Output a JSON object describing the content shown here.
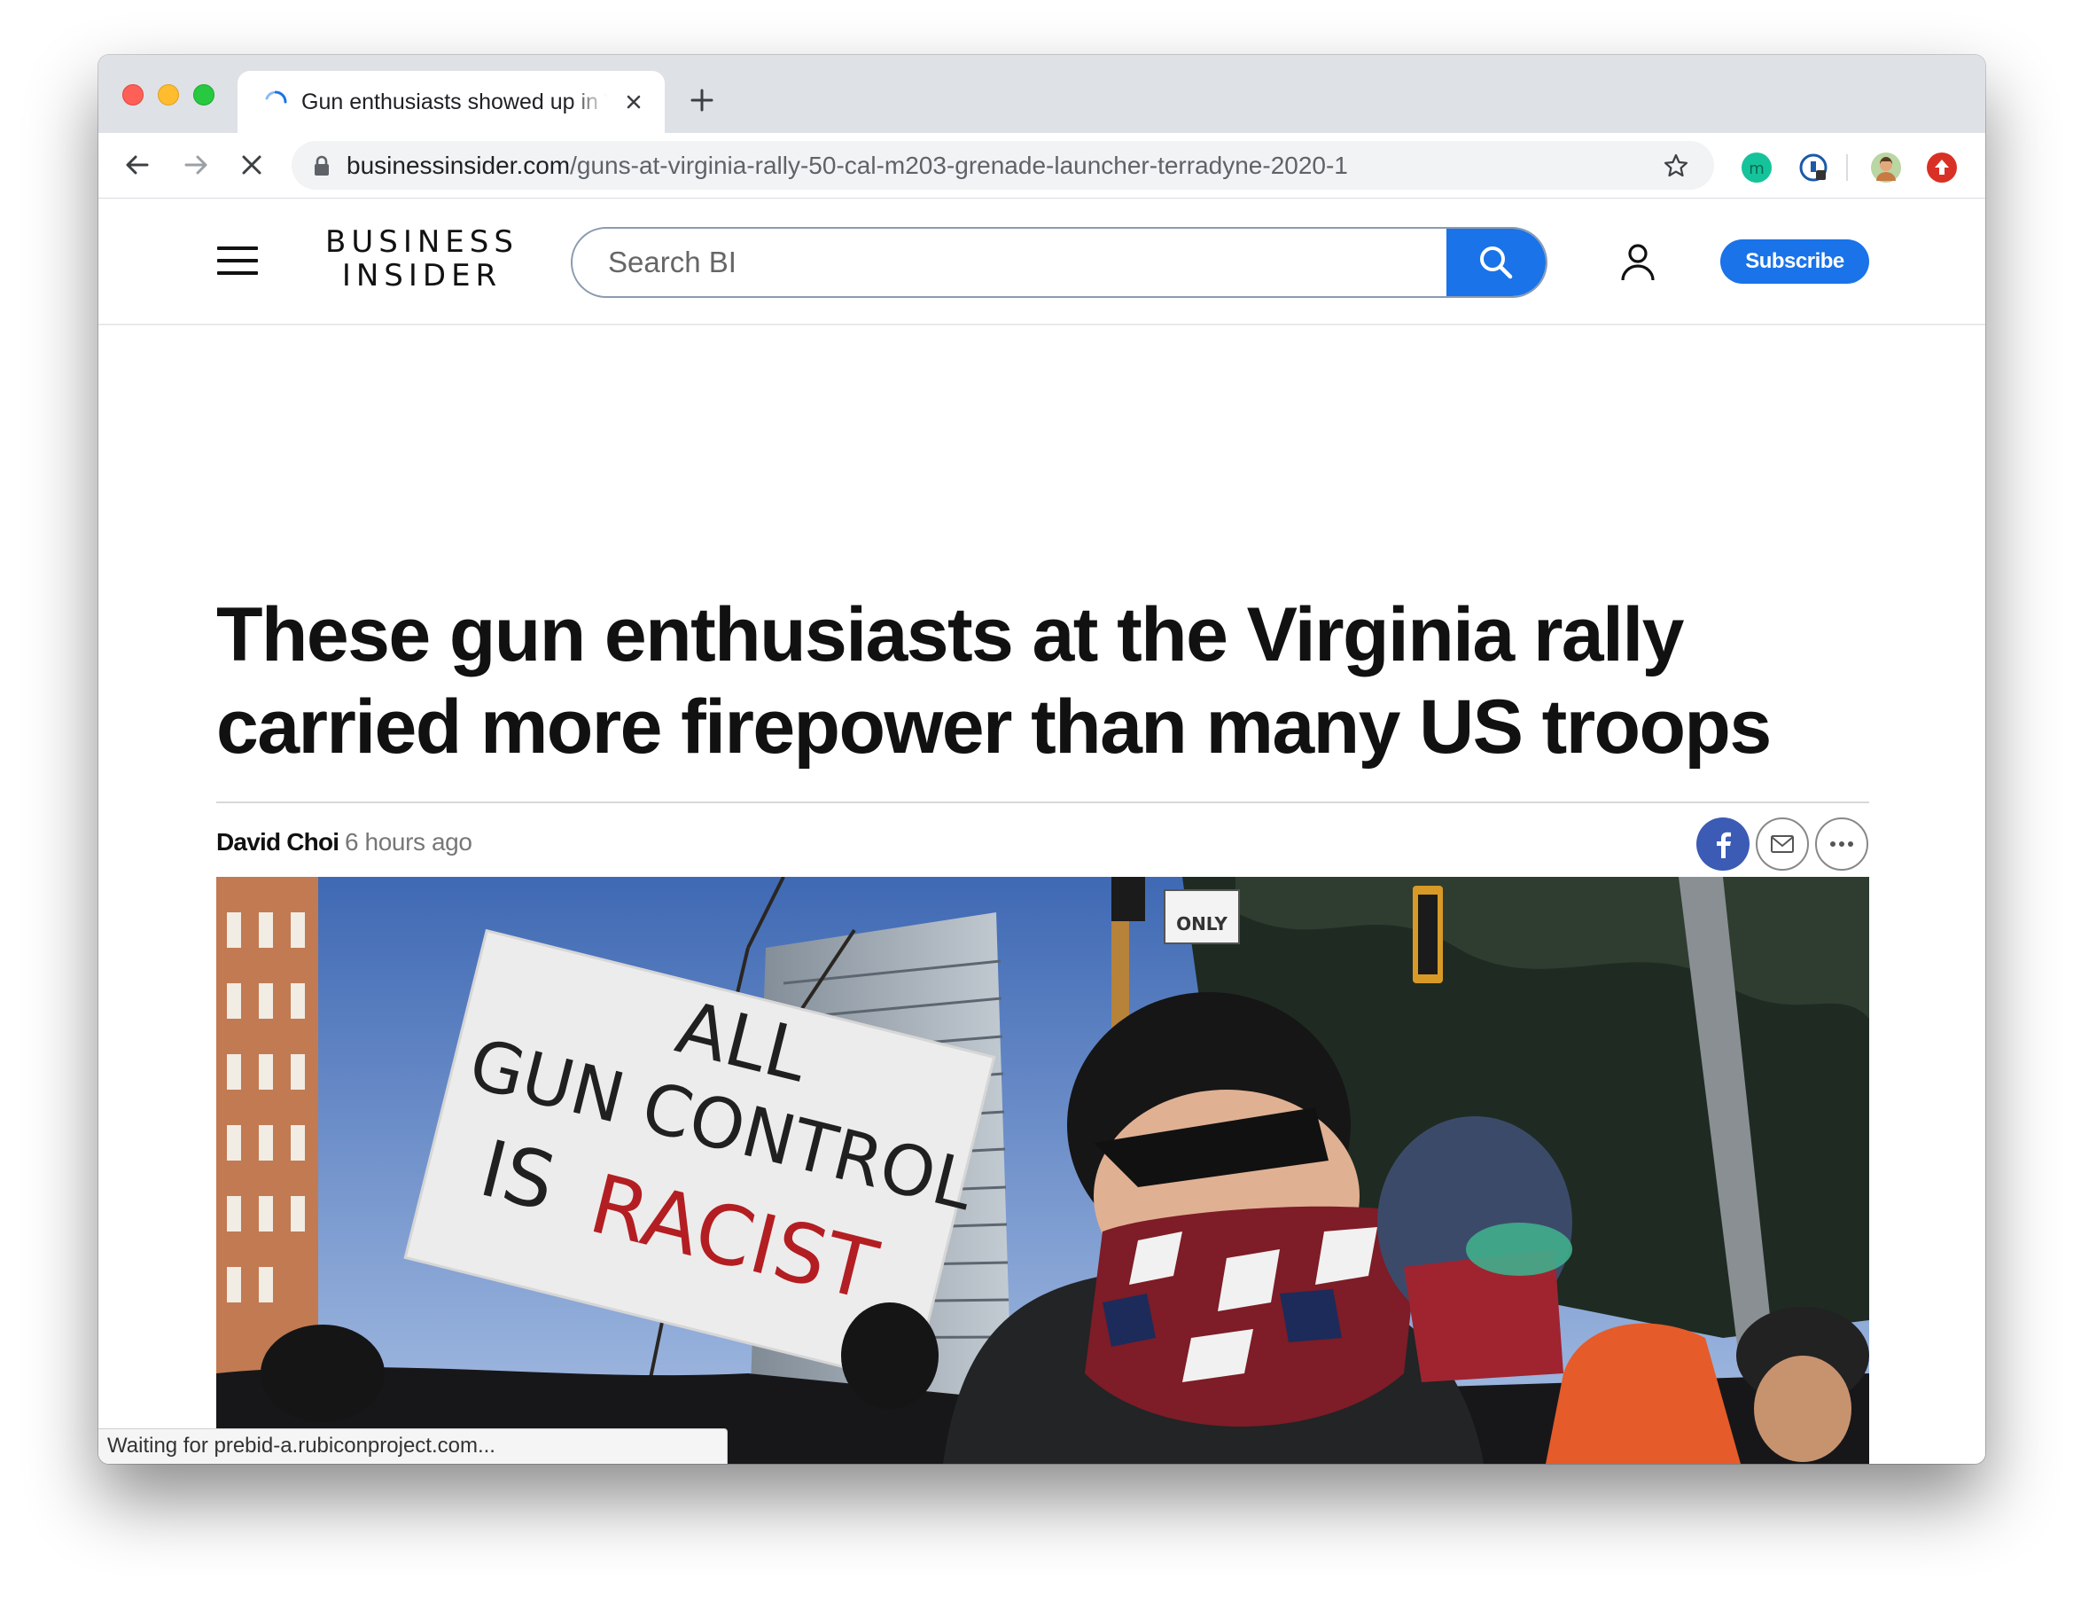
{
  "browser": {
    "tab_title": "Gun enthusiasts showed up in Virginia",
    "url_host": "businessinsider.com",
    "url_path": "/guns-at-virginia-rally-50-cal-m203-grenade-launcher-terradyne-2020-1",
    "status_text": "Waiting for prebid-a.rubiconproject.com..."
  },
  "site": {
    "logo_line1": "BUSINESS",
    "logo_line2": "INSIDER",
    "search_placeholder": "Search BI",
    "subscribe_label": "Subscribe",
    "brand_color": "#1a73e8"
  },
  "article": {
    "headline_line1": "These gun enthusiasts at the Virginia rally",
    "headline_line2": "carried more firepower than many US troops",
    "author": "David Choi",
    "time_ago": "6 hours ago"
  },
  "hero_image": {
    "sign_line1": "ALL",
    "sign_line2": "GUN CONTROL",
    "sign_line3_a": "IS",
    "sign_line3_b": "RACIST",
    "street_sign": "ONLY"
  },
  "icons": {
    "share": [
      "facebook-icon",
      "mail-icon",
      "more-icon"
    ],
    "extensions": [
      "grammarly-icon",
      "password-manager-icon",
      "profile-avatar-icon",
      "ext-update-icon"
    ]
  }
}
